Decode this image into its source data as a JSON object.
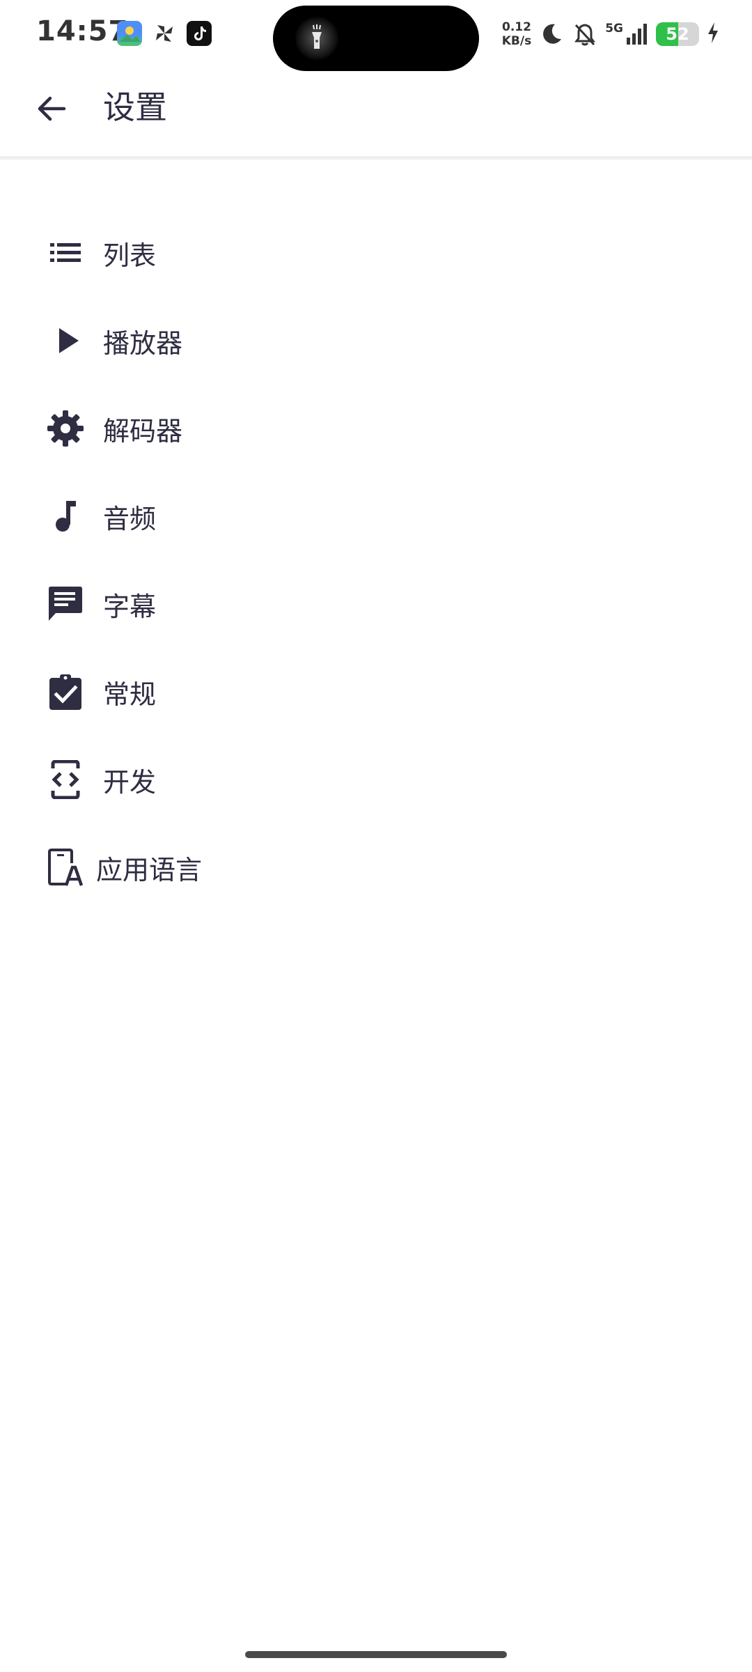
{
  "status_bar": {
    "time": "14:57",
    "net_speed_value": "0.12",
    "net_speed_unit": "KB/s",
    "network_type": "5G",
    "battery_level": "52",
    "battery_percent": 52,
    "notification_icons": [
      "gallery-icon",
      "pinwheel-icon",
      "tiktok-icon"
    ],
    "status_icons": [
      "moon-icon",
      "bell-off-icon",
      "signal-icon",
      "charging-icon"
    ],
    "island_icon": "flashlight-icon"
  },
  "app_bar": {
    "title": "设置",
    "back_icon": "arrow-back-icon"
  },
  "settings": {
    "items": [
      {
        "label": "列表",
        "icon": "list-icon"
      },
      {
        "label": "播放器",
        "icon": "play-icon"
      },
      {
        "label": "解码器",
        "icon": "gear-icon"
      },
      {
        "label": "音频",
        "icon": "music-note-icon"
      },
      {
        "label": "字幕",
        "icon": "subtitles-icon"
      },
      {
        "label": "常规",
        "icon": "clipboard-check-icon"
      },
      {
        "label": "开发",
        "icon": "developer-icon"
      },
      {
        "label": "应用语言",
        "icon": "app-language-icon"
      }
    ]
  },
  "colors": {
    "text": "#2e2d42",
    "icon": "#2e2d42",
    "divider": "#efefef",
    "battery": "#2fc04a",
    "background": "#ffffff"
  }
}
